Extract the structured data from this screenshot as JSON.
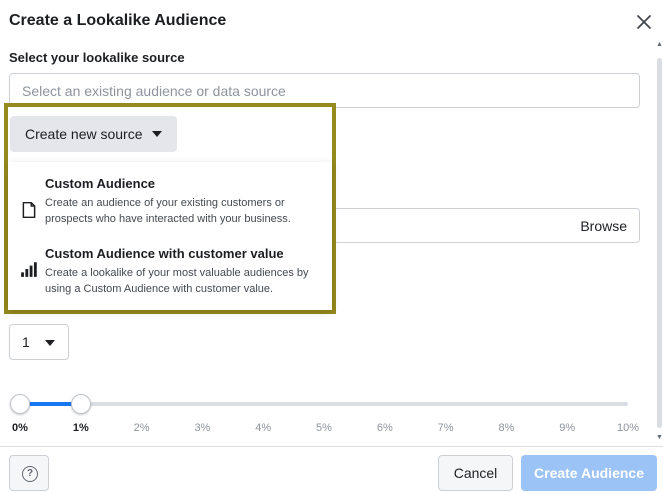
{
  "dialog": {
    "title": "Create a Lookalike Audience",
    "close_icon": "close-icon"
  },
  "source": {
    "label": "Select your lookalike source",
    "placeholder": "Select an existing audience or data source"
  },
  "create_new": {
    "label": "Create new source",
    "caret_icon": "caret-down-icon"
  },
  "menu": {
    "items": [
      {
        "title": "Custom Audience",
        "description": "Create an audience of your existing customers or prospects who have interacted with your business.",
        "icon": "document-icon"
      },
      {
        "title": "Custom Audience with customer value",
        "description": "Create a lookalike of your most valuable audiences by using a Custom Audience with customer value.",
        "icon": "bar-chart-icon"
      }
    ]
  },
  "location": {
    "browse_label": "Browse"
  },
  "audience_count": {
    "value": "1",
    "caret_icon": "caret-down-icon"
  },
  "slider": {
    "ticks": [
      "0%",
      "1%",
      "2%",
      "3%",
      "4%",
      "5%",
      "6%",
      "7%",
      "8%",
      "9%",
      "10%"
    ],
    "start_percent": 0,
    "end_percent": 1
  },
  "footer": {
    "help_label": "?",
    "cancel_label": "Cancel",
    "create_label": "Create Audience"
  },
  "colors": {
    "accent": "#1877f2",
    "accent_disabled": "#9cc3f5",
    "highlight_border": "#958a1d"
  }
}
